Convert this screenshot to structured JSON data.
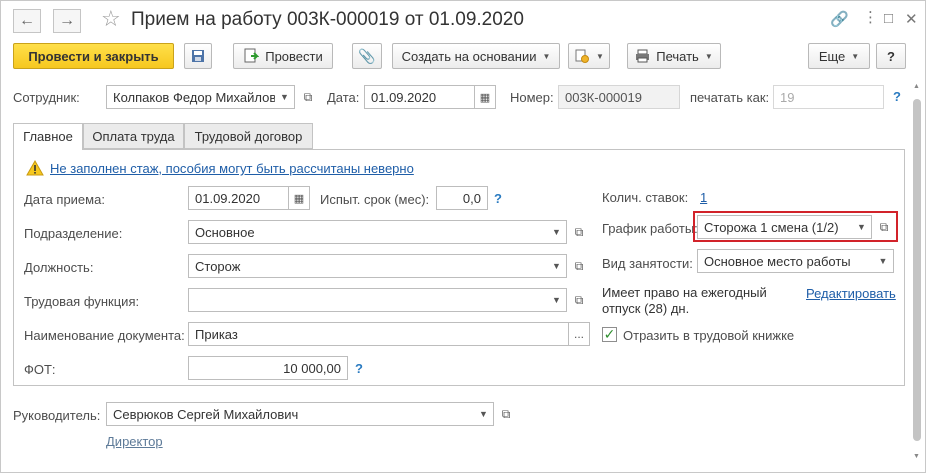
{
  "window": {
    "title": "Прием на работу 003К-000019 от 01.09.2020"
  },
  "toolbar": {
    "post_close": "Провести и закрыть",
    "post": "Провести",
    "create_based": "Создать на основании",
    "print": "Печать",
    "more": "Еще",
    "help": "?"
  },
  "header": {
    "employee_label": "Сотрудник:",
    "employee_value": "Колпаков Федор Михайлов",
    "date_label": "Дата:",
    "date_value": "01.09.2020",
    "number_label": "Номер:",
    "number_value": "003К-000019",
    "print_as_label": "печатать как:",
    "print_as_value": "19",
    "print_as_help": "?"
  },
  "tabs": [
    {
      "label": "Главное",
      "active": true
    },
    {
      "label": "Оплата труда",
      "active": false
    },
    {
      "label": "Трудовой договор",
      "active": false
    }
  ],
  "main": {
    "warning_link": "Не заполнен стаж, пособия могут быть рассчитаны неверно",
    "hire_date_label": "Дата приема:",
    "hire_date_value": "01.09.2020",
    "probation_label": "Испыт. срок (мес):",
    "probation_value": "0,0",
    "probation_help": "?",
    "department_label": "Подразделение:",
    "department_value": "Основное",
    "position_label": "Должность:",
    "position_value": "Сторож",
    "labor_function_label": "Трудовая функция:",
    "labor_function_value": "",
    "doc_name_label": "Наименование документа:",
    "doc_name_value": "Приказ",
    "doc_name_btn": "...",
    "fot_label": "ФОТ:",
    "fot_value": "10 000,00",
    "fot_help": "?",
    "rates_label": "Колич. ставок:",
    "rates_value": "1",
    "schedule_label": "График работы:",
    "schedule_value": "Сторожа 1 смена (1/2)",
    "employment_label": "Вид занятости:",
    "employment_value": "Основное место работы",
    "vacation_text_1": "Имеет право на ежегодный",
    "vacation_text_2": "отпуск (28) дн.",
    "edit_link": "Редактировать",
    "workbook_checked": true,
    "workbook_label": "Отразить в трудовой книжке"
  },
  "footer": {
    "manager_label": "Руководитель:",
    "manager_value": "Севрюков Сергей Михайлович",
    "manager_position": "Директор"
  },
  "colors": {
    "primary_button": "#f6c81f",
    "highlight_border": "#d2232a",
    "link": "#1f5ea8",
    "help_icon": "#2a7bc1"
  }
}
